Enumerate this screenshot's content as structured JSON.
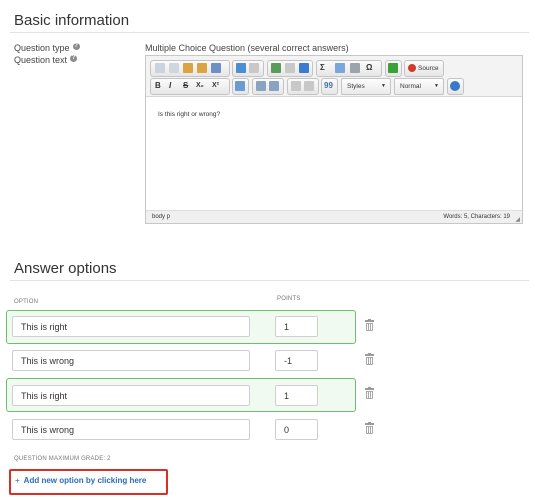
{
  "basic": {
    "heading": "Basic information",
    "question_type_label": "Question type",
    "question_type_value": "Multiple Choice Question (several correct answers)",
    "question_text_label": "Question text",
    "help_glyph": "?"
  },
  "editor": {
    "source_label": "Source",
    "styles_label": "Styles",
    "format_label": "Normal",
    "content": "Is this right or wrong?",
    "path": "body  p",
    "word_count": "Words: 5, Characters: 19",
    "bold": "B",
    "italic": "I",
    "strike": "S",
    "subscript": "X₂",
    "superscript": "X²",
    "quote": "99",
    "sigma": "Σ",
    "omega": "Ω"
  },
  "answers": {
    "heading": "Answer options",
    "col_option": "OPTION",
    "col_points": "POINTS",
    "rows": [
      {
        "text": "This is right",
        "points": "1",
        "correct": true
      },
      {
        "text": "This is wrong",
        "points": "-1",
        "correct": false
      },
      {
        "text": "This is right",
        "points": "1",
        "correct": true
      },
      {
        "text": "This is wrong",
        "points": "0",
        "correct": false
      }
    ],
    "max_grade": "QUESTION MAXIMUM GRADE: 2",
    "add_plus": "+",
    "add_label": "Add new option by clicking here"
  },
  "colors": {
    "correct_border": "#6bc16b",
    "correct_bg": "#f1faf1",
    "link": "#2a6db5",
    "highlight": "#d93025"
  }
}
